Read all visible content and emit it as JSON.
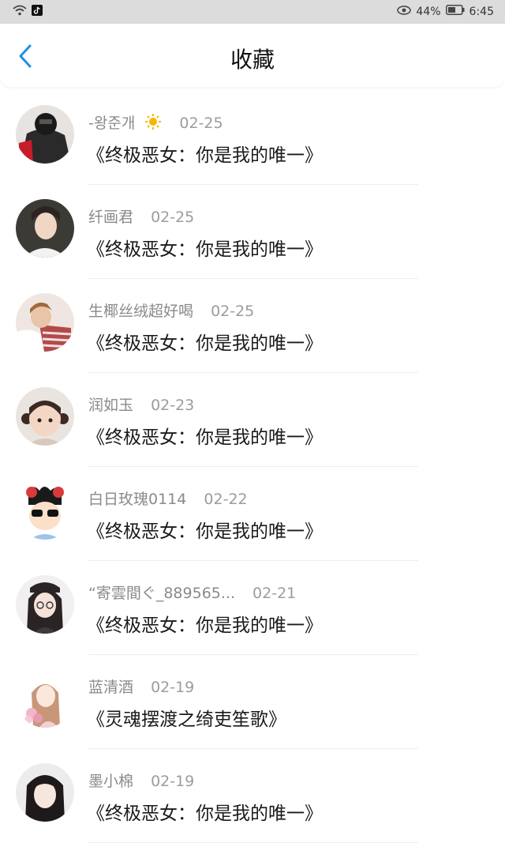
{
  "status_bar": {
    "battery": "44%",
    "time": "6:45"
  },
  "header": {
    "title": "收藏"
  },
  "items": [
    {
      "name": "-왕준개",
      "has_sun_emoji": true,
      "date": "02-25",
      "book": "《终极恶女：你是我的唯一》"
    },
    {
      "name": "纤画君",
      "date": "02-25",
      "book": "《终极恶女：你是我的唯一》"
    },
    {
      "name": "生椰丝绒超好喝",
      "date": "02-25",
      "book": "《终极恶女：你是我的唯一》"
    },
    {
      "name": "润如玉",
      "date": "02-23",
      "book": "《终极恶女：你是我的唯一》"
    },
    {
      "name": "白日玫瑰0114",
      "date": "02-22",
      "book": "《终极恶女：你是我的唯一》"
    },
    {
      "name": "“寄雲間ぐ_889565...",
      "date": "02-21",
      "book": "《终极恶女：你是我的唯一》"
    },
    {
      "name": "蓝清酒",
      "date": "02-19",
      "book": "《灵魂摆渡之绮吏笙歌》"
    },
    {
      "name": "墨小棉",
      "date": "02-19",
      "book": "《终极恶女：你是我的唯一》"
    }
  ],
  "colors": {
    "accent": "#1E90E6",
    "status_bar_bg": "#DCDCDC",
    "secondary_text": "#8A8A8A"
  }
}
